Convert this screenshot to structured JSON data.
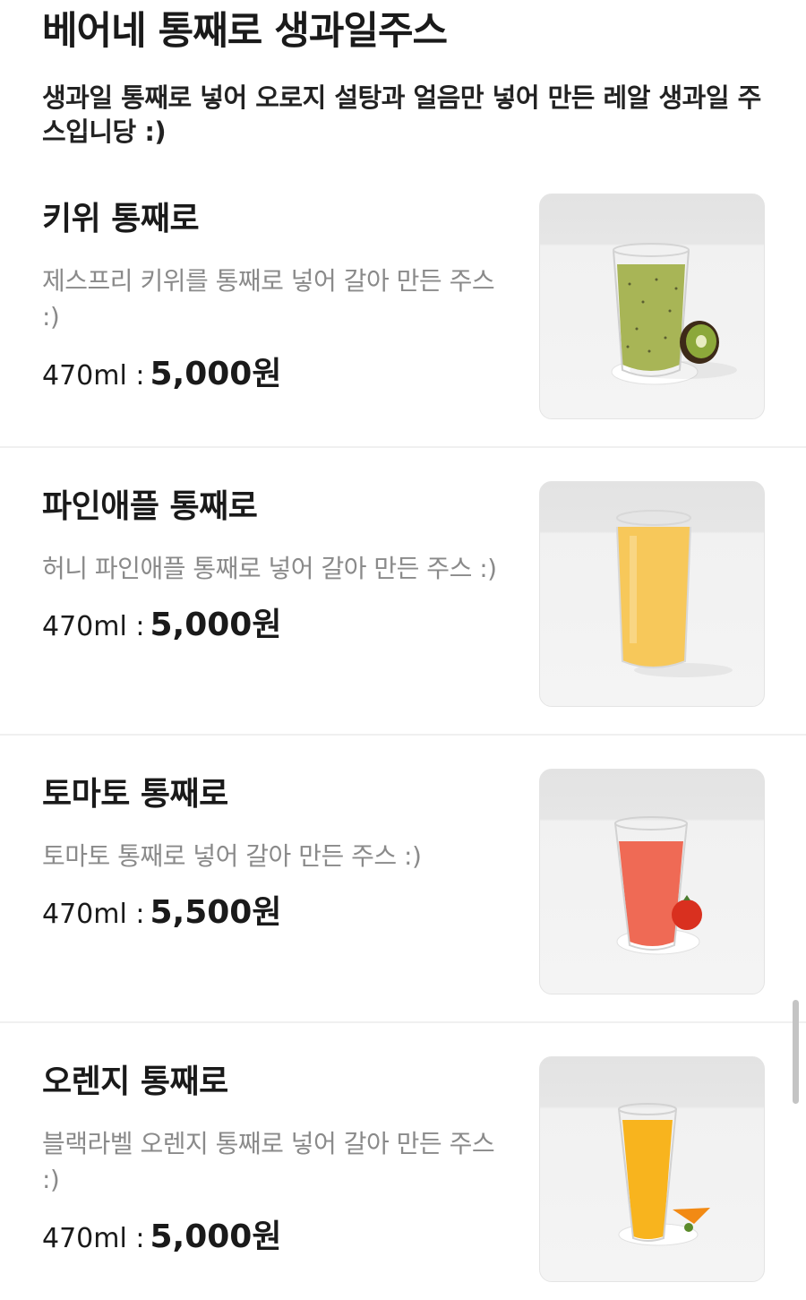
{
  "section": {
    "title": "베어네 통째로 생과일주스",
    "description": "생과일 통째로 넣어 오로지 설탕과 얼음만 넣어 만든 레알 생과일 주스입니당 :)"
  },
  "items": [
    {
      "name": "키위 통째로",
      "description": "제스프리 키위를 통째로 넣어 갈아 만든 주스 :)",
      "volume": "470ml :",
      "price": "5,000원",
      "image_icon": "kiwi-juice-image",
      "juice_color": "#a8b556",
      "garnish": "kiwi"
    },
    {
      "name": "파인애플 통째로",
      "description": "허니 파인애플 통째로 넣어 갈아 만든 주스 :)",
      "volume": "470ml :",
      "price": "5,000원",
      "image_icon": "pineapple-juice-image",
      "juice_color": "#f7c85a",
      "garnish": "none"
    },
    {
      "name": "토마토 통째로",
      "description": "토마토 통째로 넣어 갈아 만든 주스 :)",
      "volume": "470ml :",
      "price": "5,500원",
      "image_icon": "tomato-juice-image",
      "juice_color": "#ef6a55",
      "garnish": "tomato"
    },
    {
      "name": "오렌지 통째로",
      "description": "블랙라벨 오렌지 통째로 넣어 갈아 만든 주스 :)",
      "volume": "470ml :",
      "price": "5,000원",
      "image_icon": "orange-juice-image",
      "juice_color": "#f8b41e",
      "garnish": "orange"
    }
  ]
}
